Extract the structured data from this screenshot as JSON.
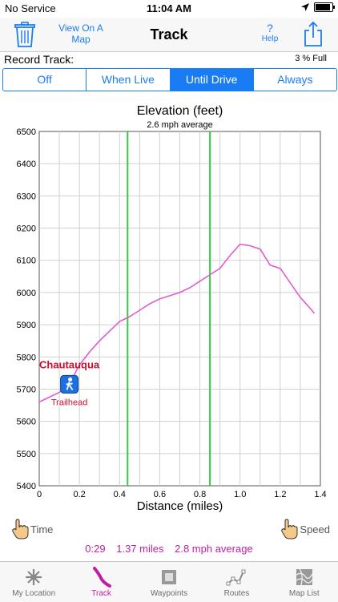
{
  "status_bar": {
    "carrier": "No Service",
    "time": "11:04 AM",
    "battery_percent": 0.9
  },
  "navbar": {
    "title": "Track",
    "view_on_map": "View On A Map",
    "help_q": "?",
    "help_label": "Help"
  },
  "record_track": {
    "label": "Record Track:",
    "capacity": "3 % Full",
    "options": [
      "Off",
      "When Live",
      "Until Drive",
      "Always"
    ],
    "selected": "Until Drive"
  },
  "chart_data": {
    "type": "line",
    "title": "Elevation (feet)",
    "subtitle": "2.6 mph average",
    "xlabel": "Distance (miles)",
    "xlim": [
      0,
      1.4
    ],
    "ylim": [
      5400,
      6500
    ],
    "x_ticks": [
      "0",
      "0.2",
      "0.4",
      "0.6",
      "0.8",
      "1.0",
      "1.2",
      "1.4"
    ],
    "y_ticks": [
      "5400",
      "5500",
      "5600",
      "5700",
      "5800",
      "5900",
      "6000",
      "6100",
      "6200",
      "6300",
      "6400",
      "6500"
    ],
    "grid": true,
    "line_color": "#e05cd0",
    "marker_color": "#2ecc40",
    "markers": [
      0.44,
      0.85
    ],
    "annotation": {
      "title": "Chautauqua",
      "subtitle": "Trailhead",
      "x": 0.15,
      "y": 5715,
      "icon": "hiker-icon"
    },
    "series": [
      {
        "x": [
          0,
          0.05,
          0.1,
          0.15,
          0.2,
          0.25,
          0.3,
          0.35,
          0.4,
          0.45,
          0.5,
          0.55,
          0.6,
          0.65,
          0.7,
          0.75,
          0.8,
          0.85,
          0.9,
          0.95,
          1.0,
          1.05,
          1.1,
          1.15,
          1.2,
          1.25,
          1.3,
          1.35,
          1.37
        ],
        "values": [
          5660,
          5675,
          5690,
          5715,
          5775,
          5815,
          5850,
          5880,
          5910,
          5925,
          5945,
          5965,
          5980,
          5990,
          6000,
          6015,
          6035,
          6055,
          6075,
          6115,
          6150,
          6145,
          6135,
          6085,
          6075,
          6030,
          5985,
          5950,
          5935
        ]
      }
    ]
  },
  "controls": {
    "time": "Time",
    "speed": "Speed"
  },
  "summary": {
    "duration": "0:29",
    "distance": "1.37 miles",
    "speed": "2.8 mph average"
  },
  "tabs": [
    {
      "label": "My Location",
      "icon": "compass-icon"
    },
    {
      "label": "Track",
      "icon": "track-icon"
    },
    {
      "label": "Waypoints",
      "icon": "waypoint-icon"
    },
    {
      "label": "Routes",
      "icon": "routes-icon"
    },
    {
      "label": "Map List",
      "icon": "map-icon"
    }
  ],
  "active_tab": "Track",
  "colors": {
    "accent": "#1a7cf5",
    "track": "#c21ea3"
  }
}
